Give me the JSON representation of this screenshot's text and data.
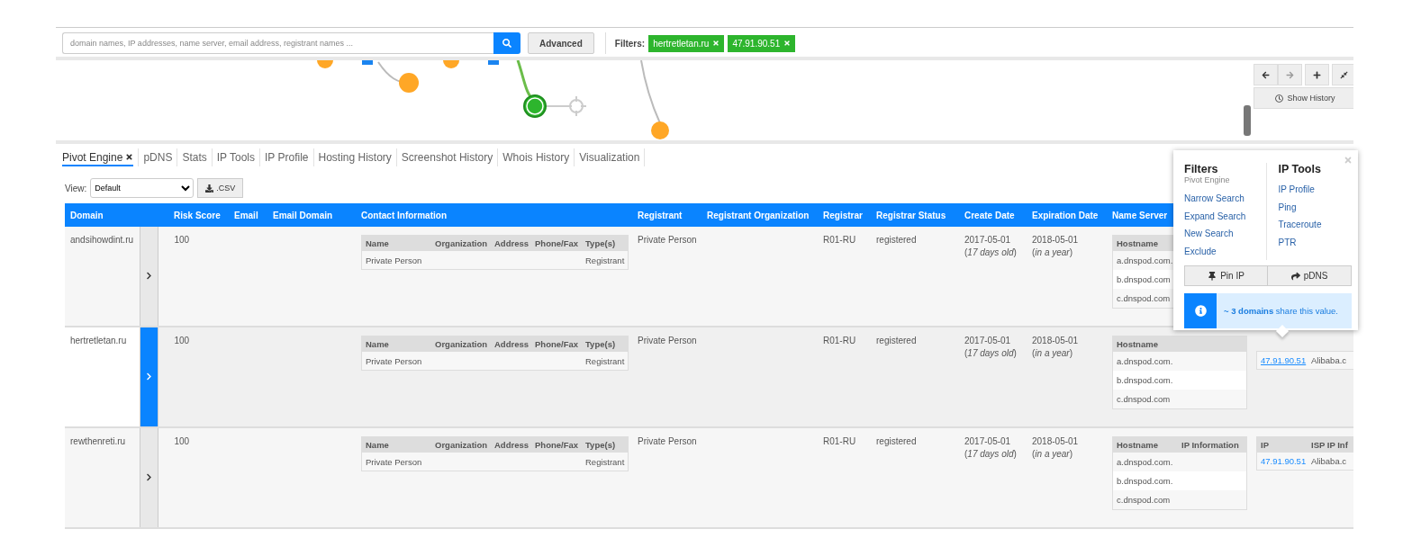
{
  "search": {
    "placeholder": "domain names, IP addresses, name server, email address, registrant names ...",
    "advanced": "Advanced"
  },
  "filters": {
    "label": "Filters:",
    "chips": [
      {
        "label": "hertretletan.ru"
      },
      {
        "label": "47.91.90.51"
      }
    ]
  },
  "graph_controls": {
    "show_history": "Show History"
  },
  "tabs": [
    {
      "label": "Pivot Engine",
      "selected": true,
      "closable": true
    },
    {
      "label": "pDNS",
      "selected": false,
      "closable": false
    },
    {
      "label": "Stats",
      "selected": false,
      "closable": false
    },
    {
      "label": "IP Tools",
      "selected": false,
      "closable": false
    },
    {
      "label": "IP Profile",
      "selected": false,
      "closable": false
    },
    {
      "label": "Hosting History",
      "selected": false,
      "closable": false
    },
    {
      "label": "Screenshot History",
      "selected": false,
      "closable": false
    },
    {
      "label": "Whois History",
      "selected": false,
      "closable": false
    },
    {
      "label": "Visualization",
      "selected": false,
      "closable": false
    }
  ],
  "view": {
    "label": "View:",
    "value": "Default",
    "export": ".CSV"
  },
  "table": {
    "columns": [
      "Domain",
      "Risk Score",
      "Email",
      "Email Domain",
      "Contact Information",
      "Registrant",
      "Registrant Organization",
      "Registrar",
      "Registrar Status",
      "Create Date",
      "Expiration Date",
      "Name Server"
    ],
    "rows": [
      {
        "domain": "andsihowdint.ru",
        "selected": false,
        "risk_score": "100",
        "contacts": {
          "columns": [
            "Name",
            "Organization",
            "Address",
            "Phone/Fax",
            "Type(s)"
          ],
          "rows": [
            {
              "name": "Private Person",
              "types": "Registrant"
            }
          ]
        },
        "registrant": "Private Person",
        "registrar": "R01-RU",
        "registrar_status": "registered",
        "create_date": "2017-05-01",
        "create_age": "(*17 days old*)",
        "expiration_date": "2018-05-01",
        "expiration_relative": "(*in a year*)",
        "name_servers": {
          "columns": [
            "Hostname"
          ],
          "hostnames": [
            "a.dnspod.com.",
            "b.dnspod.com",
            "c.dnspod.com"
          ]
        }
      },
      {
        "domain": "hertretletan.ru",
        "selected": true,
        "risk_score": "100",
        "contacts": {
          "columns": [
            "Name",
            "Organization",
            "Address",
            "Phone/Fax",
            "Type(s)"
          ],
          "rows": [
            {
              "name": "Private Person",
              "types": "Registrant"
            }
          ]
        },
        "registrant": "Private Person",
        "registrar": "R01-RU",
        "registrar_status": "registered",
        "create_date": "2017-05-01",
        "create_age": "(*17 days old*)",
        "expiration_date": "2018-05-01",
        "expiration_relative": "(*in a year*)",
        "name_servers": {
          "columns": [
            "Hostname"
          ],
          "hostnames": [
            "a.dnspod.com.",
            "b.dnspod.com.",
            "c.dnspod.com"
          ]
        },
        "ips": {
          "rows": [
            {
              "ip": "47.91.90.51",
              "isp": "Alibaba.c",
              "hovered": true
            }
          ]
        }
      },
      {
        "domain": "rewthenreti.ru",
        "selected": false,
        "risk_score": "100",
        "contacts": {
          "columns": [
            "Name",
            "Organization",
            "Address",
            "Phone/Fax",
            "Type(s)"
          ],
          "rows": [
            {
              "name": "Private Person",
              "types": "Registrant"
            }
          ]
        },
        "registrant": "Private Person",
        "registrar": "R01-RU",
        "registrar_status": "registered",
        "create_date": "2017-05-01",
        "create_age": "(*17 days old*)",
        "expiration_date": "2018-05-01",
        "expiration_relative": "(*in a year*)",
        "name_servers": {
          "columns": [
            "Hostname",
            "IP Information"
          ],
          "hostnames": [
            "a.dnspod.com.",
            "b.dnspod.com.",
            "c.dnspod.com"
          ]
        },
        "ips": {
          "columns": [
            "IP",
            "ISP IP Inf"
          ],
          "rows": [
            {
              "ip": "47.91.90.51",
              "isp": "Alibaba.c",
              "hovered": false
            }
          ]
        }
      }
    ]
  },
  "popover": {
    "filters": {
      "title": "Filters",
      "subtitle": "Pivot Engine",
      "links": [
        "Narrow Search",
        "Expand Search",
        "New Search",
        "Exclude"
      ]
    },
    "ip_tools": {
      "title": "IP Tools",
      "links": [
        "IP Profile",
        "Ping",
        "Traceroute",
        "PTR"
      ]
    },
    "buttons": [
      {
        "label": "Pin IP",
        "kind": "pin"
      },
      {
        "label": "pDNS",
        "kind": "share"
      }
    ],
    "info": "**~ 3 domains** share this value."
  }
}
